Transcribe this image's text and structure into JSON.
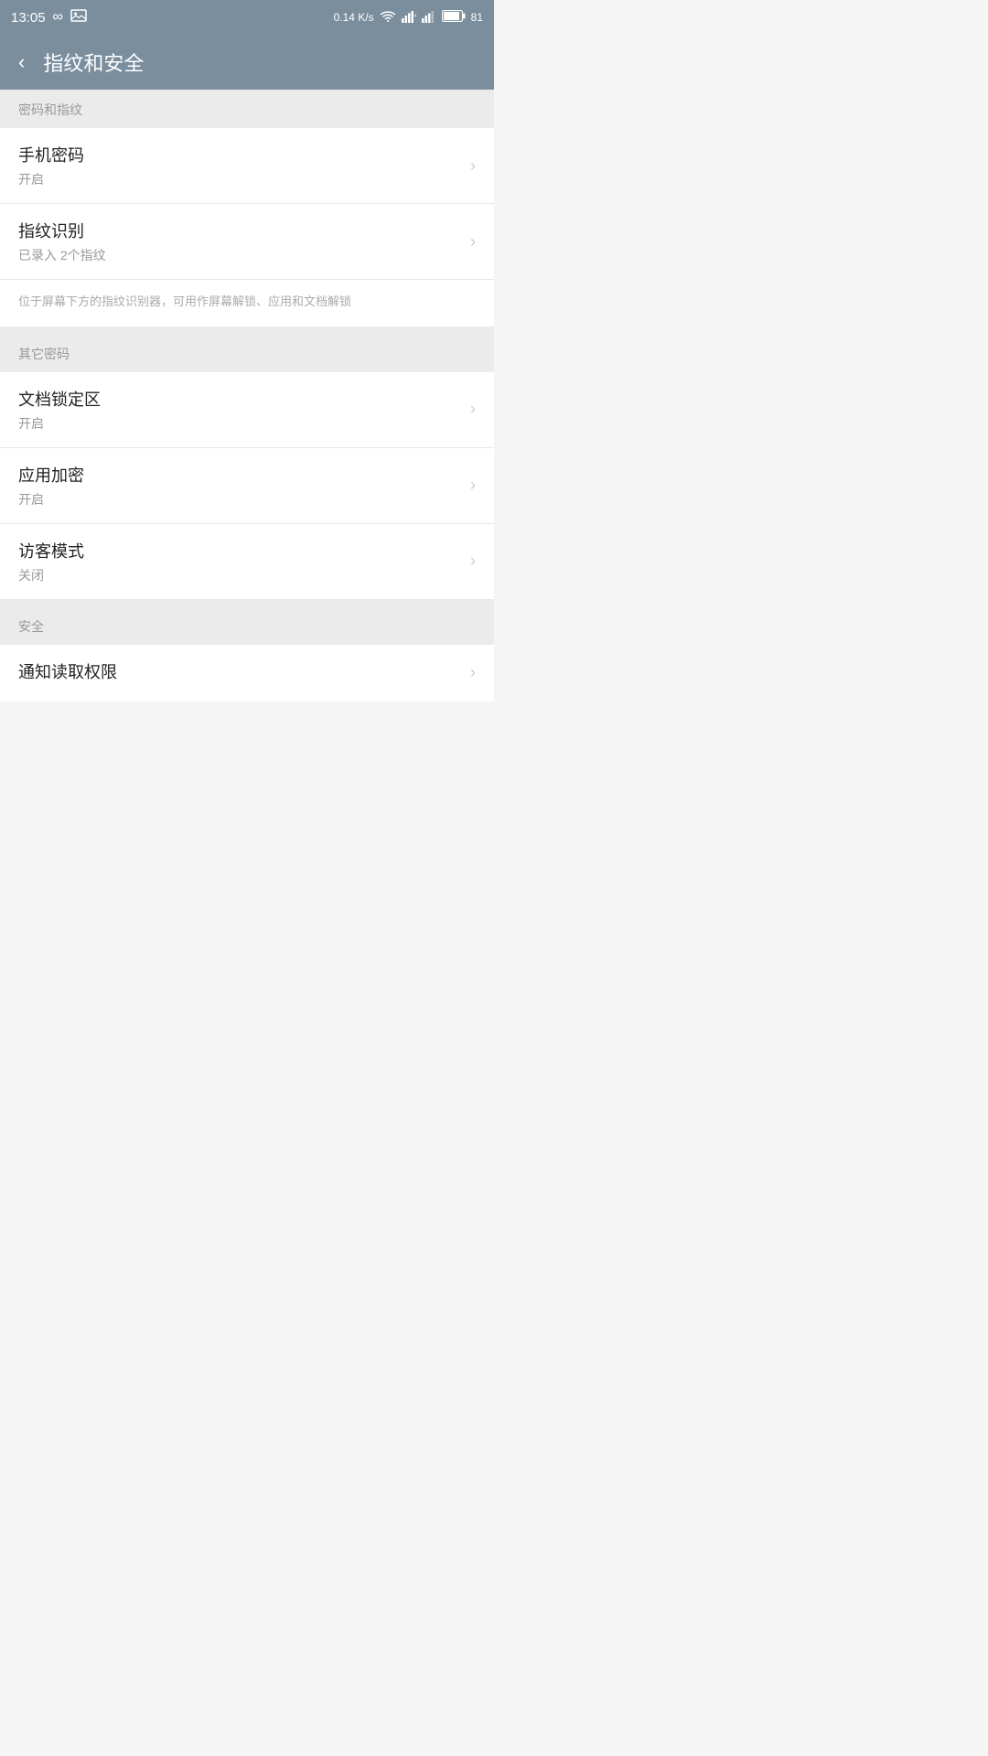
{
  "statusBar": {
    "time": "13:05",
    "speed": "0.14 K/s",
    "battery": "81",
    "icons": {
      "infinity": "∞",
      "image": "🖼",
      "wifi": "wifi",
      "signal1": "signal",
      "signal2": "signal",
      "battery": "battery"
    }
  },
  "header": {
    "backLabel": "‹",
    "title": "指纹和安全"
  },
  "sections": [
    {
      "id": "password-fingerprint",
      "sectionTitle": "密码和指纹",
      "items": [
        {
          "id": "phone-password",
          "title": "手机密码",
          "subtitle": "开启",
          "hasChevron": true
        },
        {
          "id": "fingerprint",
          "title": "指纹识别",
          "subtitle": "已录入 2个指纹",
          "hasChevron": true
        }
      ],
      "description": "位于屏幕下方的指纹识别器，可用作屏幕解锁、应用和文档解锁"
    },
    {
      "id": "other-passwords",
      "sectionTitle": "其它密码",
      "items": [
        {
          "id": "document-lock",
          "title": "文档锁定区",
          "subtitle": "开启",
          "hasChevron": true
        },
        {
          "id": "app-encrypt",
          "title": "应用加密",
          "subtitle": "开启",
          "hasChevron": true
        },
        {
          "id": "guest-mode",
          "title": "访客模式",
          "subtitle": "关闭",
          "hasChevron": true
        }
      ]
    },
    {
      "id": "security",
      "sectionTitle": "安全",
      "items": [
        {
          "id": "notification-permission",
          "title": "通知读取权限",
          "subtitle": "",
          "hasChevron": true
        }
      ]
    }
  ]
}
